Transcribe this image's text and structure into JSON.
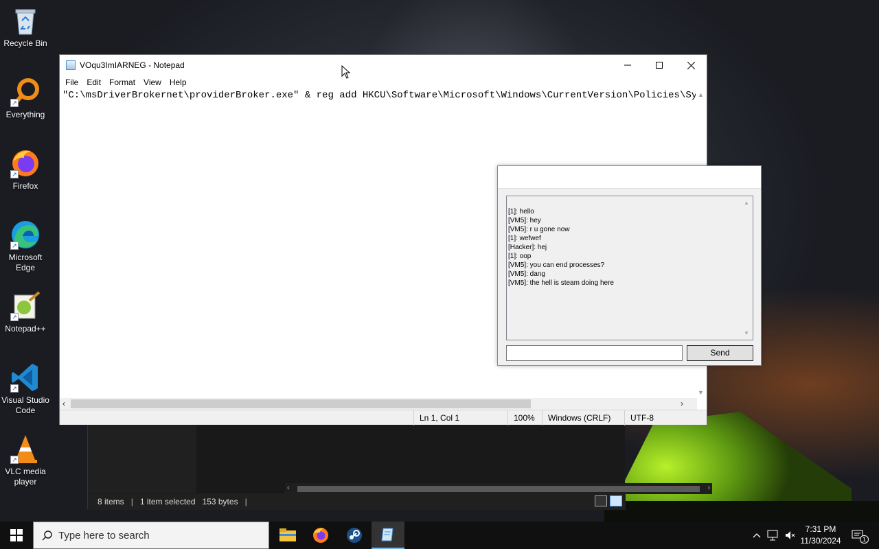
{
  "desktop": {
    "icons": [
      {
        "label": "Recycle Bin",
        "icon": "recycle-bin-icon"
      },
      {
        "label": "Everything",
        "icon": "everything-search-icon"
      },
      {
        "label": "Firefox",
        "icon": "firefox-icon"
      },
      {
        "label": "Microsoft Edge",
        "icon": "edge-icon"
      },
      {
        "label": "Notepad++",
        "icon": "notepad-plus-plus-icon"
      },
      {
        "label": "Visual Studio Code",
        "icon": "vscode-icon"
      },
      {
        "label": "VLC media player",
        "icon": "vlc-icon"
      }
    ]
  },
  "explorer": {
    "items_count": "8 items",
    "selection": "1 item selected",
    "size": "153 bytes"
  },
  "notepad": {
    "title": "VOqu3ImIARNEG - Notepad",
    "menu": [
      "File",
      "Edit",
      "Format",
      "View",
      "Help"
    ],
    "content": "\"C:\\msDriverBrokernet\\providerBroker.exe\" & reg add HKCU\\Software\\Microsoft\\Windows\\CurrentVersion\\Policies\\System",
    "status": {
      "position": "Ln 1, Col 1",
      "zoom": "100%",
      "line_ending": "Windows (CRLF)",
      "encoding": "UTF-8"
    }
  },
  "chat": {
    "messages": [
      "[1]: hello",
      "[VM5]: hey",
      "[VM5]: r u gone now",
      "[1]: wefwef",
      "[Hacker]: hej",
      "[1]: oop",
      "[VM5]: you can end processes?",
      "[VM5]: dang",
      "[VM5]: the hell is steam doing here"
    ],
    "input_value": "",
    "send_label": "Send"
  },
  "taskbar": {
    "search_placeholder": "Type here to search",
    "apps": [
      "file-explorer-icon",
      "firefox-icon",
      "steam-icon",
      "notepad-icon"
    ],
    "time": "7:31 PM",
    "date": "11/30/2024",
    "notification_count": "1"
  }
}
